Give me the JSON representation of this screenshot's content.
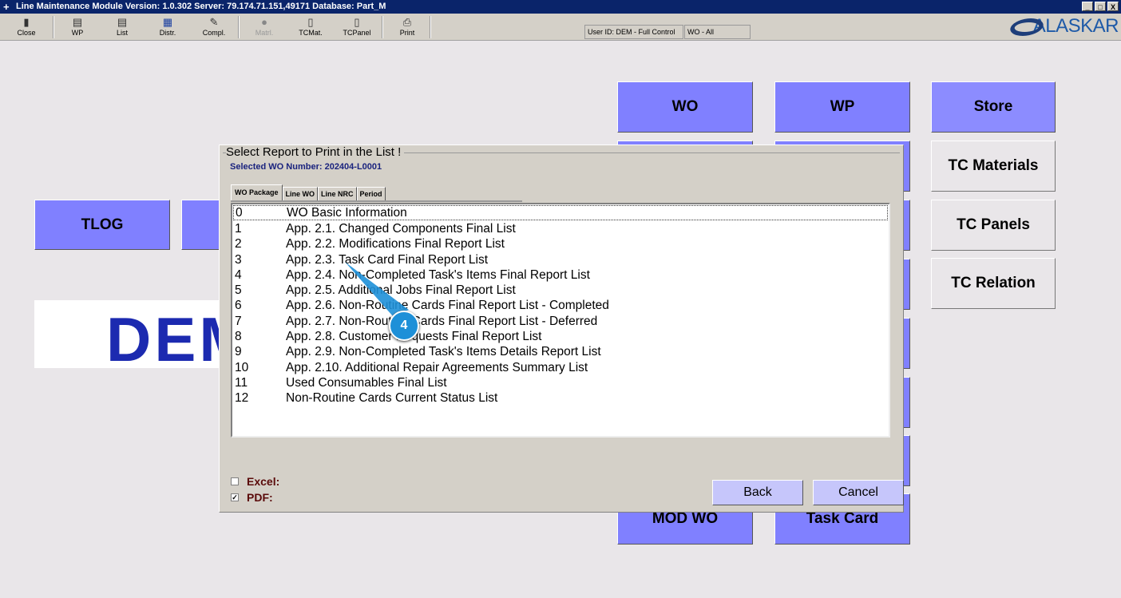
{
  "window": {
    "title": "Line Maintenance Module  Version: 1.0.302 Server: 79.174.71.151,49171 Database: Part_M",
    "controls": [
      "_",
      "□",
      "X"
    ]
  },
  "toolbar": {
    "items": [
      {
        "label": "Close",
        "icon": "exit-door-icon"
      },
      {
        "label": "WP",
        "icon": "printer-folder-icon"
      },
      {
        "label": "List",
        "icon": "printer-folder-icon"
      },
      {
        "label": "Distr.",
        "icon": "distribution-icon"
      },
      {
        "label": "Compl.",
        "icon": "complete-icon"
      },
      {
        "label": "Matrl.",
        "icon": "flask-icon",
        "disabled": true
      },
      {
        "label": "TCMat.",
        "icon": "document-icon"
      },
      {
        "label": "TCPanel",
        "icon": "document-icon"
      },
      {
        "label": "Print",
        "icon": "printer-icon"
      }
    ],
    "user": "User ID: DEM - Full Control",
    "wo_filter": "WO - All"
  },
  "logo": "ALASKAR",
  "main": {
    "buttons": {
      "wo": "WO",
      "wp": "WP",
      "store": "Store",
      "tc_materials": "TC Materials",
      "tc_panels": "TC Panels",
      "tc_relation": "TC Relation",
      "tlog": "TLOG",
      "mod_wo": "MOD WO",
      "task_card": "Task Card"
    },
    "user_banner": "DEM"
  },
  "dialog": {
    "title": "Select Report to Print in the List !",
    "selected_wo": "Selected WO Number: 202404-L0001",
    "tabs": [
      "WO Package",
      "Line WO",
      "Line NRC",
      "Period"
    ],
    "reports": [
      {
        "n": "0",
        "name": "WO Basic Information"
      },
      {
        "n": "1",
        "name": "App. 2.1. Changed Components Final List"
      },
      {
        "n": "2",
        "name": "App. 2.2. Modifications Final Report List"
      },
      {
        "n": "3",
        "name": "App. 2.3. Task Card Final Report List"
      },
      {
        "n": "4",
        "name": "App. 2.4. Non-Completed Task's Items Final Report List"
      },
      {
        "n": "5",
        "name": "App. 2.5. Additional Jobs Final Report List"
      },
      {
        "n": "6",
        "name": "App. 2.6. Non-Routine Cards Final Report List - Completed"
      },
      {
        "n": "7",
        "name": "App. 2.7. Non-Routine Cards Final Report List - Deferred"
      },
      {
        "n": "8",
        "name": "App. 2.8. Customer Requests Final Report List"
      },
      {
        "n": "9",
        "name": "App. 2.9. Non-Completed Task's Items Details Report List"
      },
      {
        "n": "10",
        "name": "App. 2.10. Additional Repair Agreements Summary List"
      },
      {
        "n": "11",
        "name": "Used Consumables Final List"
      },
      {
        "n": "12",
        "name": "Non-Routine Cards Current Status List"
      }
    ],
    "excel_label": "Excel:",
    "excel_checked": false,
    "pdf_label": "PDF:",
    "pdf_checked": true,
    "back": "Back",
    "cancel": "Cancel"
  },
  "annotation": {
    "step": "4",
    "color": "#1e90d8"
  }
}
